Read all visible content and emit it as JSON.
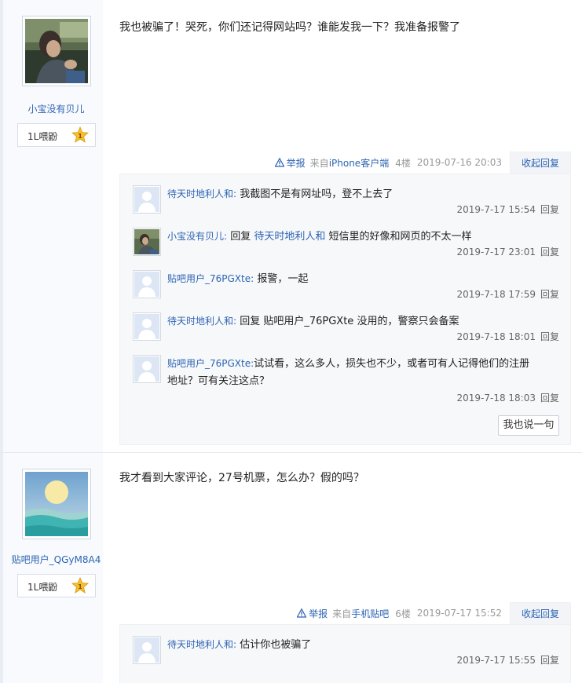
{
  "posts": [
    {
      "author": "小宝没有贝儿",
      "level": "1L喂鼢",
      "level_badge": "1",
      "content": "我也被骗了！哭死，你们还记得网站吗？谁能发我一下？我准备报警了",
      "report_label": "举报",
      "source_prefix": "来自",
      "source_name": "iPhone客户端",
      "floor": "4楼",
      "time": "2019-07-16 20:03",
      "toggle_label": "收起回复",
      "replies": [
        {
          "author": "待天时地利人和:",
          "text": "我截图不是有网址吗，登不上去了",
          "time": "2019-7-17 15:54",
          "reply_label": "回复"
        },
        {
          "author": "小宝没有贝儿:",
          "pre": "回复",
          "target": "待天时地利人和",
          "text": " 短信里的好像和网页的不太一样",
          "time": "2019-7-17 23:01",
          "reply_label": "回复"
        },
        {
          "author": "贴吧用户_76PGXte:",
          "text": "报警，一起",
          "time": "2019-7-18 17:59",
          "reply_label": "回复"
        },
        {
          "author": "待天时地利人和:",
          "pre": "回复",
          "target": "贴吧用户_76PGXte",
          "text": " 没用的，警察只会备案",
          "time": "2019-7-18 18:01",
          "reply_label": "回复"
        },
        {
          "author": "贴吧用户_76PGXte:",
          "text": "试试看，这么多人，损失也不少，或者可有人记得他们的注册",
          "text2": "地址？可有关注这点？",
          "time": "2019-7-18 18:03",
          "reply_label": "回复"
        }
      ],
      "say_label": "我也说一句"
    },
    {
      "author": "贴吧用户_QGyM8A4",
      "level": "1L喂鼢",
      "level_badge": "1",
      "content": "我才看到大家评论，27号机票，怎么办？假的吗？",
      "report_label": "举报",
      "source_prefix": "来自",
      "source_name": "手机贴吧",
      "floor": "6楼",
      "time": "2019-07-17 15:52",
      "toggle_label": "收起回复",
      "replies": [
        {
          "author": "待天时地利人和:",
          "text": "估计你也被骗了",
          "time": "2019-7-17 15:55",
          "reply_label": "回复"
        }
      ]
    }
  ],
  "colors": {
    "link": "#2d64b3",
    "sidebar_bg": "#f8fafd",
    "lzl_bg": "#f7f8fa",
    "badge": "#f5c02b"
  }
}
